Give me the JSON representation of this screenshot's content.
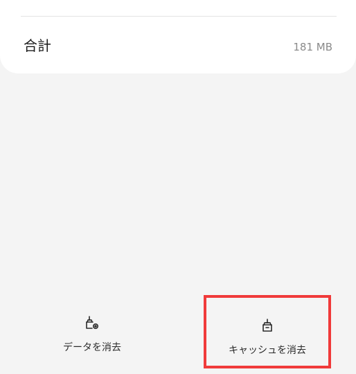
{
  "storage": {
    "total_label": "合計",
    "total_value": "181 MB"
  },
  "actions": {
    "clear_data_label": "データを消去",
    "clear_cache_label": "キャッシュを消去",
    "clear_data_icon": "broom-gear-icon",
    "clear_cache_icon": "broom-icon"
  },
  "colors": {
    "background": "#f4f4f4",
    "card": "#ffffff",
    "highlight_border": "#f03a3a"
  }
}
